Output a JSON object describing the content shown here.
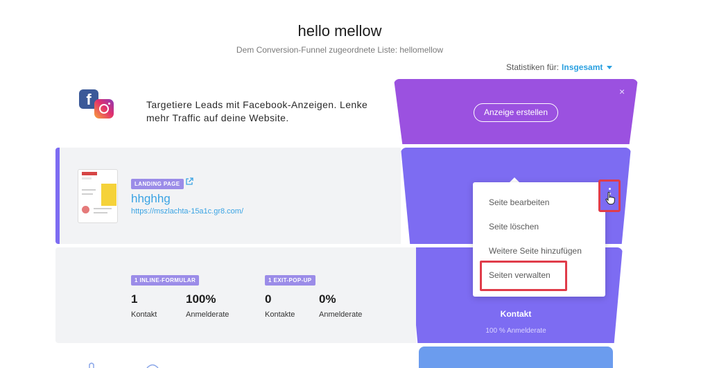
{
  "header": {
    "title": "hello mellow",
    "subtitle": "Dem Conversion-Funnel zugeordnete Liste: hellomellow",
    "stats_label": "Statistiken für:",
    "stats_value": "Insgesamt"
  },
  "promo": {
    "text": "Targetiere Leads mit Facebook-Anzeigen. Lenke mehr Traffic auf deine Website.",
    "button_label": "Anzeige erstellen",
    "close": "×",
    "icons": [
      "facebook-icon",
      "instagram-icon"
    ]
  },
  "landing_page": {
    "badge": "LANDING PAGE",
    "name": "hhghhg",
    "url": "https://mszlachta-15a1c.gr8.com/"
  },
  "forms": {
    "inline": {
      "badge": "1 INLINE-FORMULAR",
      "count": "1",
      "count_label": "Kontakt",
      "rate": "100%",
      "rate_label": "Anmelderate"
    },
    "exit": {
      "badge": "1 EXIT-POP-UP",
      "count": "0",
      "count_label": "Kontakte",
      "rate": "0%",
      "rate_label": "Anmelderate"
    }
  },
  "funnel": {
    "contact_label": "Kontakt",
    "rate_label": "100 % Anmelderate"
  },
  "menu": {
    "items": [
      "Seite bearbeiten",
      "Seite löschen",
      "Weitere Seite hinzufügen",
      "Seiten verwalten"
    ]
  },
  "colors": {
    "accent_blue": "#2aa0e0",
    "funnel_top": "#9b51e0",
    "funnel_mid": "#7d6cf2",
    "funnel_bottom": "#6b9cee",
    "highlight": "#e03c4a"
  }
}
